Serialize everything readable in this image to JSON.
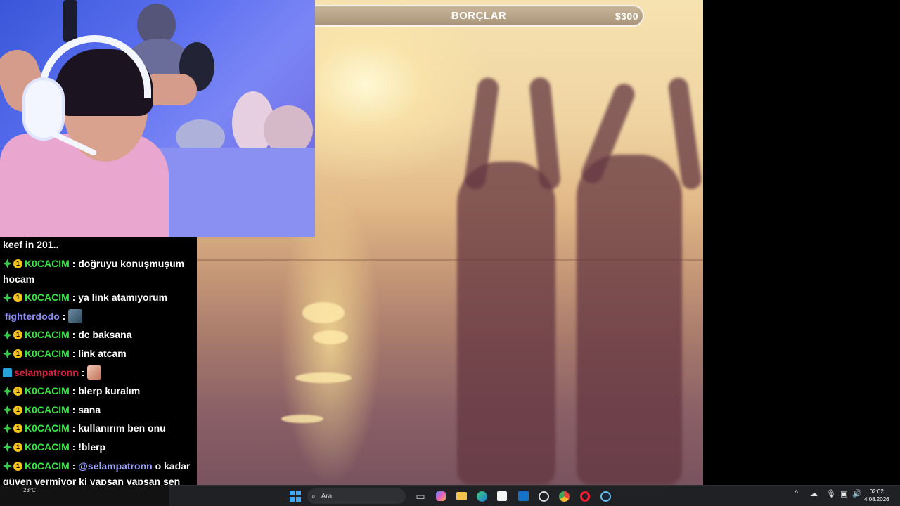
{
  "game": {
    "debt_label": "BORÇLAR",
    "debt_amount": "$300"
  },
  "chat": {
    "messages": [
      {
        "user": "",
        "text": "keef in 201.."
      },
      {
        "user": "K0CACIM",
        "text": " : doğruyu konuşmuşum hocam"
      },
      {
        "user": "K0CACIM",
        "text": " : ya link atamıyorum"
      },
      {
        "user": "fighterdodo",
        "text": " :"
      },
      {
        "user": "K0CACIM",
        "text": " : dc baksana"
      },
      {
        "user": "K0CACIM",
        "text": " : link atcam"
      },
      {
        "user": "selampatronn",
        "text": " :"
      },
      {
        "user": "K0CACIM",
        "text": " : blerp kuralım"
      },
      {
        "user": "K0CACIM",
        "text": " : sana"
      },
      {
        "user": "K0CACIM",
        "text": " : kullanırım ben onu"
      },
      {
        "user": "K0CACIM",
        "text": " : !blerp"
      },
      {
        "user": "K0CACIM",
        "text": " : ",
        "mention": "@selampatronn",
        "text_after": " o kadar güven vermiyor ki yapsan yapsan sen yaparısn"
      }
    ]
  },
  "taskbar": {
    "weather_temp": "23°C",
    "search_placeholder": "Ara",
    "clock_time": "02:02",
    "clock_date": "4.08.2026"
  },
  "colors": {
    "chat_user_green": "#3ee34a",
    "chat_user_blue": "#8a8cf2",
    "chat_user_red": "#d81f3e",
    "mention": "#9aa3ff"
  }
}
